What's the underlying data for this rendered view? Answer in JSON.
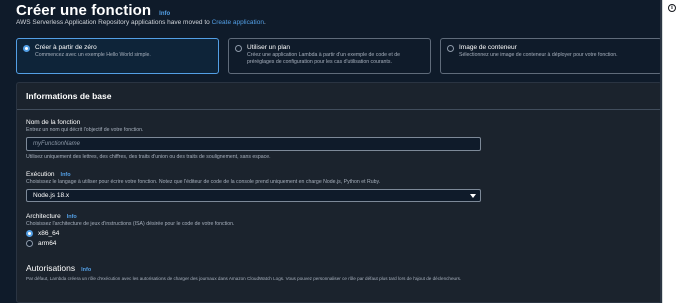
{
  "header": {
    "title": "Créer une fonction",
    "info": "Info"
  },
  "notice": {
    "text": "AWS Serverless Application Repository applications have moved to ",
    "link": "Create application",
    "suffix": "."
  },
  "options": [
    {
      "title": "Créer à partir de zéro",
      "desc": "Commencez avec un exemple Hello World simple.",
      "selected": true
    },
    {
      "title": "Utiliser un plan",
      "desc_line1": "Créez une application Lambda à partir d'un exemple de code et de",
      "desc_line2": "préréglages de configuration pour les cas d'utilisation courants.",
      "selected": false
    },
    {
      "title": "Image de conteneur",
      "desc": "Sélectionnez une image de conteneur à déployer pour votre fonction.",
      "selected": false
    }
  ],
  "basic_info": {
    "title": "Informations de base",
    "function_name": {
      "label": "Nom de la fonction",
      "desc": "Entrez un nom qui décrit l'objectif de votre fonction.",
      "placeholder": "myFunctionName",
      "hint": "Utilisez uniquement des lettres, des chiffres, des traits d'union ou des traits de soulignement, sans espace."
    },
    "runtime": {
      "label": "Exécution",
      "info": "Info",
      "desc": "Choisissez le langage à utiliser pour écrire votre fonction. Notez que l'éditeur de code de la console prend uniquement en charge Node.js, Python et Ruby.",
      "value": "Node.js 18.x"
    },
    "architecture": {
      "label": "Architecture",
      "info": "Info",
      "desc": "Choisissez l'architecture de jeux d'instructions (ISA) désirée pour le code de votre fonction.",
      "options": [
        "x86_64",
        "arm64"
      ],
      "selected": "x86_64"
    },
    "permissions": {
      "title": "Autorisations",
      "info": "Info",
      "desc": "Par défaut, Lambda créera un rôle d'exécution avec les autorisations de charger des journaux dans Amazon CloudWatch Logs. Vous pouvez personnaliser ce rôle par défaut plus tard lors de l'ajout de déclencheurs."
    }
  },
  "colors": {
    "accent": "#539fe5",
    "background": "#0f1b2a",
    "panel": "#1b232d"
  },
  "icons": {
    "side_panel": "info-circle-icon"
  }
}
